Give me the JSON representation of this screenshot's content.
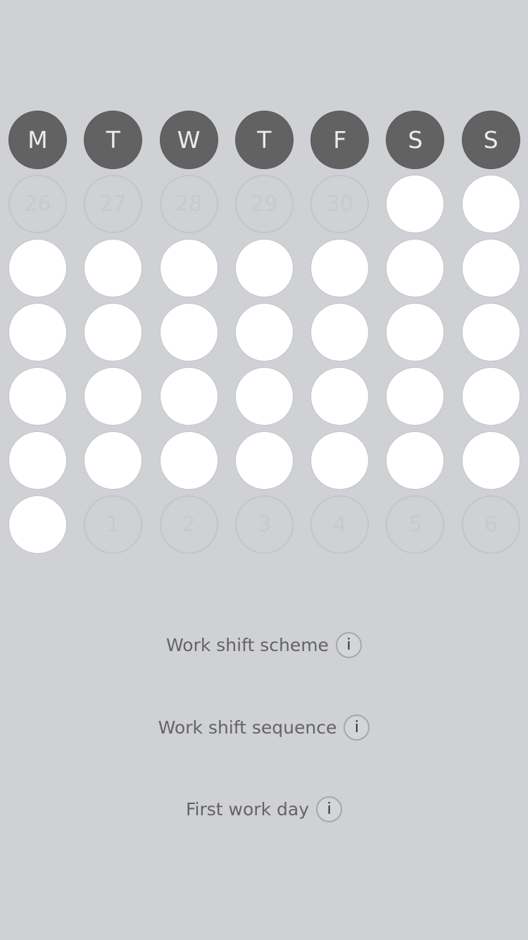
{
  "calendar": {
    "weekdays": [
      "M",
      "T",
      "W",
      "T",
      "F",
      "S",
      "S"
    ],
    "weeks": [
      [
        {
          "t": "26",
          "o": true
        },
        {
          "t": "27",
          "o": true
        },
        {
          "t": "28",
          "o": true
        },
        {
          "t": "29",
          "o": true
        },
        {
          "t": "30",
          "o": true
        },
        {
          "t": "",
          "o": false
        },
        {
          "t": "",
          "o": false
        }
      ],
      [
        {
          "t": "",
          "o": false
        },
        {
          "t": "",
          "o": false
        },
        {
          "t": "",
          "o": false
        },
        {
          "t": "",
          "o": false
        },
        {
          "t": "",
          "o": false
        },
        {
          "t": "",
          "o": false
        },
        {
          "t": "",
          "o": false
        }
      ],
      [
        {
          "t": "",
          "o": false
        },
        {
          "t": "",
          "o": false
        },
        {
          "t": "",
          "o": false
        },
        {
          "t": "",
          "o": false
        },
        {
          "t": "",
          "o": false
        },
        {
          "t": "",
          "o": false
        },
        {
          "t": "",
          "o": false
        }
      ],
      [
        {
          "t": "",
          "o": false
        },
        {
          "t": "",
          "o": false
        },
        {
          "t": "",
          "o": false
        },
        {
          "t": "",
          "o": false
        },
        {
          "t": "",
          "o": false
        },
        {
          "t": "",
          "o": false
        },
        {
          "t": "",
          "o": false
        }
      ],
      [
        {
          "t": "",
          "o": false
        },
        {
          "t": "",
          "o": false
        },
        {
          "t": "",
          "o": false
        },
        {
          "t": "",
          "o": false
        },
        {
          "t": "",
          "o": false
        },
        {
          "t": "",
          "o": false
        },
        {
          "t": "",
          "o": false
        }
      ],
      [
        {
          "t": "",
          "o": false
        },
        {
          "t": "1",
          "o": true
        },
        {
          "t": "2",
          "o": true
        },
        {
          "t": "3",
          "o": true
        },
        {
          "t": "4",
          "o": true
        },
        {
          "t": "5",
          "o": true
        },
        {
          "t": "6",
          "o": true
        }
      ]
    ]
  },
  "settings": {
    "scheme_label": "Work shift scheme",
    "sequence_label": "Work shift sequence",
    "first_day_label": "First work day",
    "info_glyph": "i"
  },
  "colors": {
    "background": "#d0d1d5",
    "header_circle": "#626262",
    "day_circle": "#ffffff"
  }
}
